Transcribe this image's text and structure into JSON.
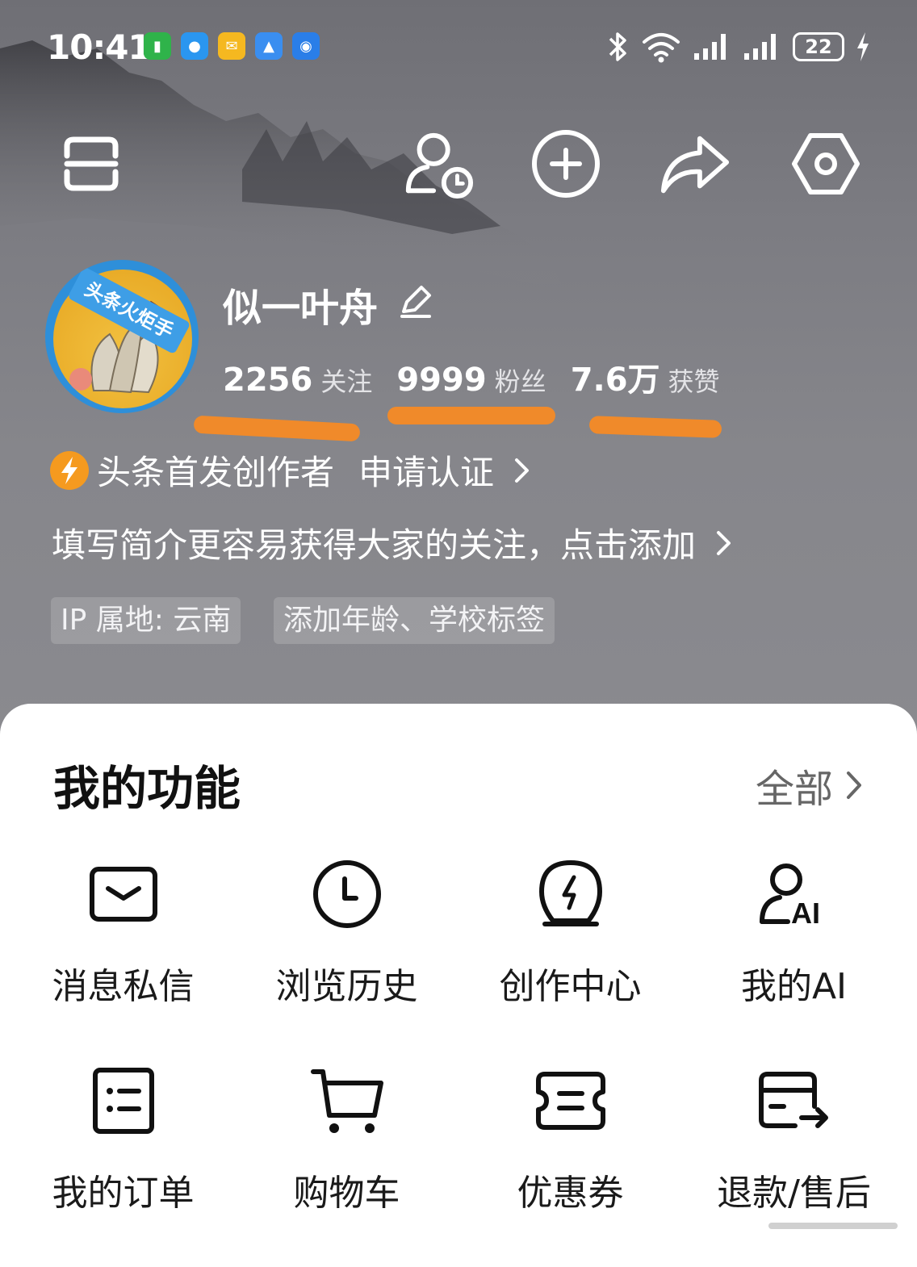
{
  "status_bar": {
    "time": "10:41",
    "battery": "22",
    "left_icons": [
      "battery-saver-icon",
      "chat-icon",
      "mail-icon",
      "education-icon",
      "browser-icon"
    ],
    "right_icons": [
      "bluetooth-icon",
      "wifi-icon",
      "signal-icon",
      "signal-icon",
      "charging-icon"
    ]
  },
  "top_bar": {
    "icons": [
      "scan-icon",
      "visitor-history-icon",
      "add-icon",
      "share-icon",
      "settings-icon"
    ]
  },
  "profile": {
    "avatar_badge": "头条火炬手",
    "username": "似一叶舟",
    "stats": [
      {
        "value": "2256",
        "label": "关注"
      },
      {
        "value": "9999",
        "label": "粉丝"
      },
      {
        "value": "7.6万",
        "label": "获赞"
      }
    ],
    "creator_badge": "头条首发创作者",
    "apply_link": "申请认证",
    "bio_prompt": "填写简介更容易获得大家的关注，点击添加",
    "tags": [
      "IP 属地: 云南",
      "添加年龄、学校标签"
    ]
  },
  "features": {
    "title": "我的功能",
    "all_label": "全部",
    "items": [
      {
        "label": "消息私信",
        "icon": "message-icon"
      },
      {
        "label": "浏览历史",
        "icon": "clock-icon"
      },
      {
        "label": "创作中心",
        "icon": "creator-bulb-icon"
      },
      {
        "label": "我的AI",
        "icon": "ai-assistant-icon"
      },
      {
        "label": "我的订单",
        "icon": "order-list-icon"
      },
      {
        "label": "购物车",
        "icon": "cart-icon"
      },
      {
        "label": "优惠券",
        "icon": "coupon-icon"
      },
      {
        "label": "退款/售后",
        "icon": "refund-card-icon"
      }
    ]
  },
  "colors": {
    "accent": "#f59a1f",
    "highlight_underline": "#f08a2a",
    "avatar_ring": "#2e8fd9"
  }
}
